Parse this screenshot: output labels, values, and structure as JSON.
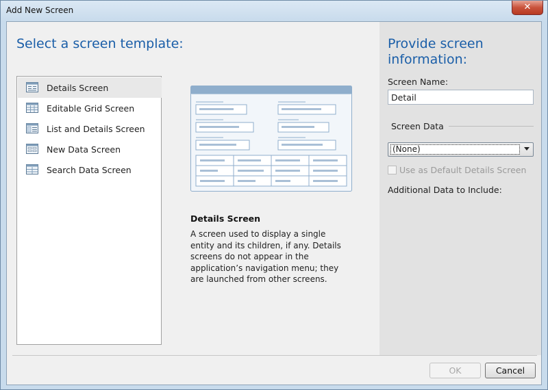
{
  "window": {
    "title": "Add New Screen",
    "close_label": "✕"
  },
  "left": {
    "heading": "Select a screen template:"
  },
  "templates": [
    {
      "label": "Details Screen",
      "icon": "details-screen-icon",
      "selected": true
    },
    {
      "label": "Editable Grid Screen",
      "icon": "grid-screen-icon",
      "selected": false
    },
    {
      "label": "List and Details Screen",
      "icon": "list-details-screen-icon",
      "selected": false
    },
    {
      "label": "New Data Screen",
      "icon": "new-data-screen-icon",
      "selected": false
    },
    {
      "label": "Search Data Screen",
      "icon": "search-data-screen-icon",
      "selected": false
    }
  ],
  "description": {
    "title": "Details Screen",
    "text": "A screen used to display a single entity and its children, if any.  Details screens do not appear in the application’s navigation menu; they are launched from other screens."
  },
  "right": {
    "heading": "Provide screen information:",
    "screen_name_label": "Screen Name:",
    "screen_name_value": "Detail",
    "screen_data_label": "Screen Data",
    "screen_data_value": "(None)",
    "default_details_label": "Use as Default Details Screen",
    "default_details_checked": false,
    "additional_data_label": "Additional Data to Include:"
  },
  "buttons": {
    "ok_label": "OK",
    "ok_enabled": false,
    "cancel_label": "Cancel"
  },
  "colors": {
    "heading": "#1a5ea8",
    "accent": "#8faecc"
  }
}
